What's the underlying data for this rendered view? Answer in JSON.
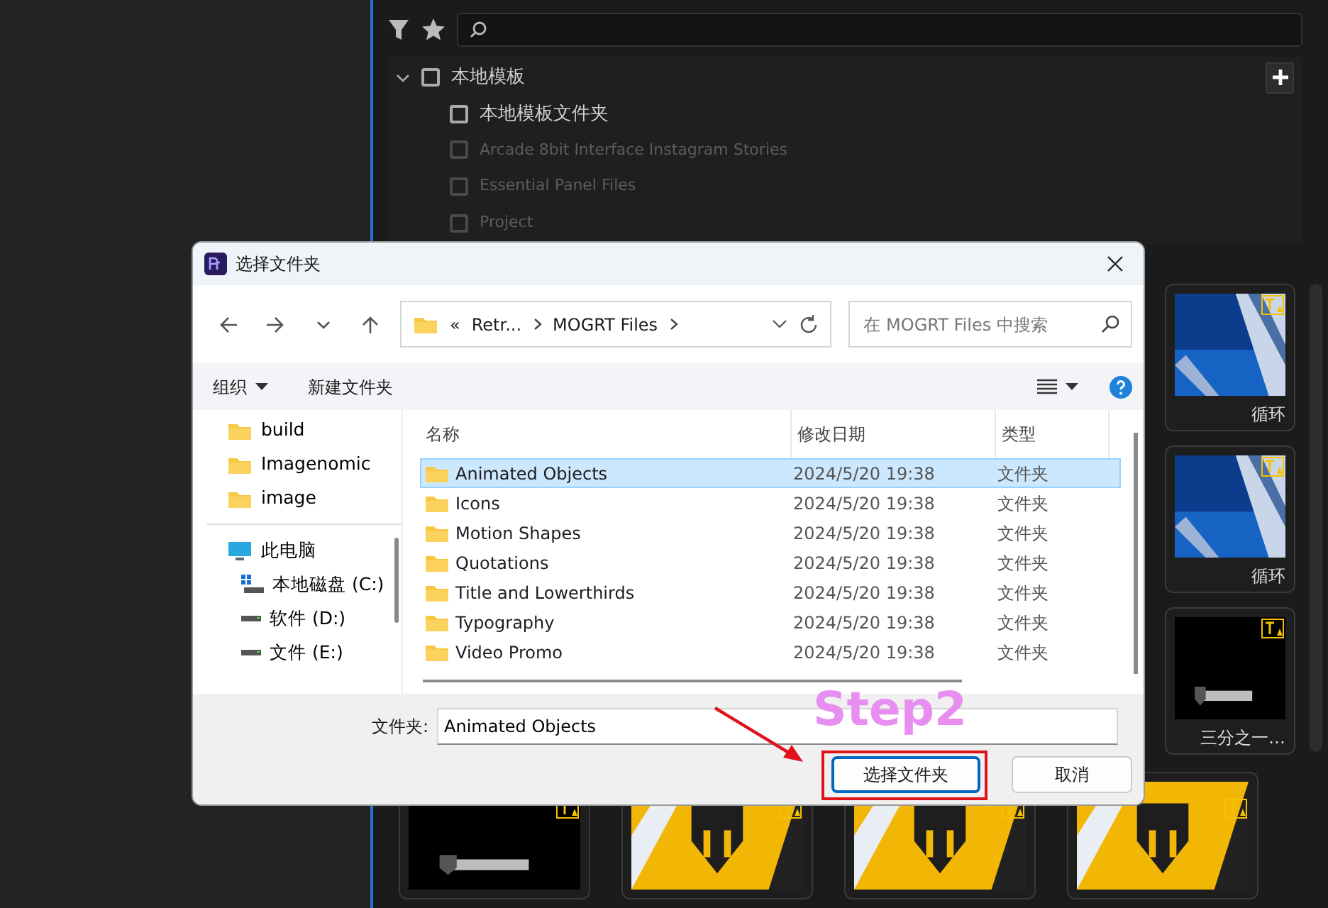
{
  "tree": {
    "label": "本地模板",
    "expanded": true,
    "checked": false,
    "children": [
      {
        "label": "本地模板文件夹",
        "checked": false,
        "disabled": false
      },
      {
        "label": "Arcade 8bit Interface Instagram Stories",
        "checked": false,
        "disabled": true
      },
      {
        "label": "Essential Panel Files",
        "checked": false,
        "disabled": true
      },
      {
        "label": "Project",
        "checked": false,
        "disabled": true
      }
    ]
  },
  "side_templates": [
    {
      "label": "循环",
      "kind": "blue"
    },
    {
      "label": "循环",
      "kind": "blue"
    },
    {
      "label": "三分之一…",
      "kind": "black"
    }
  ],
  "bottom_templates": [
    {
      "kind": "black"
    },
    {
      "kind": "gold"
    },
    {
      "kind": "gold"
    },
    {
      "kind": "gold"
    }
  ],
  "dialog": {
    "title": "选择文件夹",
    "address": {
      "overflow": "«",
      "segments": [
        "Retr...",
        "MOGRT Files"
      ]
    },
    "search": {
      "placeholder": "在 MOGRT Files 中搜索"
    },
    "toolbar": {
      "organize": "组织",
      "new_folder": "新建文件夹"
    },
    "quick_access": [
      "build",
      "Imagenomic",
      "image"
    ],
    "this_pc": "此电脑",
    "drives": [
      {
        "label": "本地磁盘 (C:)",
        "kind": "system"
      },
      {
        "label": "软件 (D:)",
        "kind": "drive"
      },
      {
        "label": "文件 (E:)",
        "kind": "drive"
      }
    ],
    "columns": [
      "名称",
      "修改日期",
      "类型"
    ],
    "rows": [
      {
        "name": "Animated Objects",
        "modified": "2024/5/20 19:38",
        "type": "文件夹",
        "selected": true
      },
      {
        "name": "Icons",
        "modified": "2024/5/20 19:38",
        "type": "文件夹",
        "selected": false
      },
      {
        "name": "Motion Shapes",
        "modified": "2024/5/20 19:38",
        "type": "文件夹",
        "selected": false
      },
      {
        "name": "Quotations",
        "modified": "2024/5/20 19:38",
        "type": "文件夹",
        "selected": false
      },
      {
        "name": "Title and Lowerthirds",
        "modified": "2024/5/20 19:38",
        "type": "文件夹",
        "selected": false
      },
      {
        "name": "Typography",
        "modified": "2024/5/20 19:38",
        "type": "文件夹",
        "selected": false
      },
      {
        "name": "Video Promo",
        "modified": "2024/5/20 19:38",
        "type": "文件夹",
        "selected": false
      }
    ],
    "folder_label": "文件夹:",
    "folder_value": "Animated Objects",
    "buttons": [
      {
        "label": "选择文件夹",
        "primary": true
      },
      {
        "label": "取消",
        "primary": false
      }
    ]
  },
  "annotation": {
    "text": "Step2"
  }
}
